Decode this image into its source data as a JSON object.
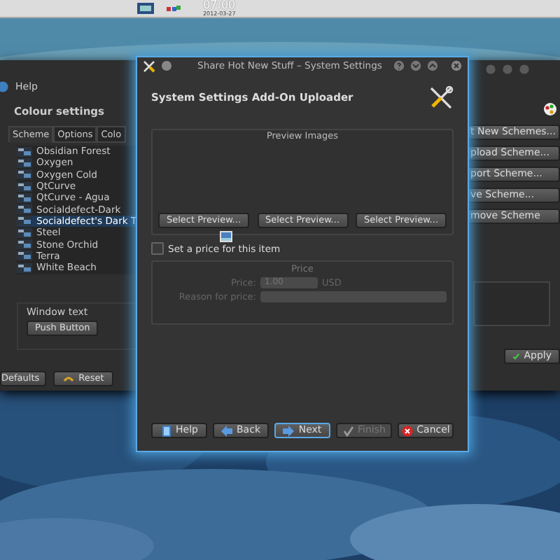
{
  "panel": {
    "clock": "07:00",
    "date": "2012-03-27"
  },
  "back_window": {
    "menu": [
      "Help"
    ],
    "title": "Colour settings",
    "tabs": [
      {
        "label": "Scheme",
        "selected": true
      },
      {
        "label": "Options",
        "selected": false
      },
      {
        "label": "Colo",
        "selected": false
      }
    ],
    "schemes": [
      {
        "name": "Obsidian Forest",
        "selected": false
      },
      {
        "name": "Oxygen",
        "selected": false
      },
      {
        "name": "Oxygen Cold",
        "selected": false
      },
      {
        "name": "QtCurve",
        "selected": false
      },
      {
        "name": "QtCurve - Agua",
        "selected": false
      },
      {
        "name": "Socialdefect-Dark",
        "selected": false
      },
      {
        "name": "Socialdefect's Dark T",
        "selected": true
      },
      {
        "name": "Steel",
        "selected": false
      },
      {
        "name": "Stone Orchid",
        "selected": false
      },
      {
        "name": "Terra",
        "selected": false
      },
      {
        "name": "White Beach",
        "selected": false
      }
    ],
    "preview_label": "Window text",
    "preview_button": "Push Button",
    "side_buttons": [
      "t New Schemes...",
      "pload Scheme...",
      "port Scheme...",
      "ve Scheme...",
      "move Scheme"
    ],
    "bottom_buttons": [
      "Defaults",
      "Reset"
    ],
    "apply_button": "Apply"
  },
  "dialog": {
    "title": "Share Hot New Stuff – System Settings",
    "heading": "System Settings Add-On Uploader",
    "preview_group": {
      "title": "Preview Images",
      "buttons": [
        "Select Preview...",
        "Select Preview...",
        "Select Preview..."
      ]
    },
    "price_checkbox": {
      "label": "Set a price for this item",
      "checked": false
    },
    "price_group": {
      "title": "Price",
      "disabled": true,
      "price_label": "Price:",
      "price_value": "1.00",
      "currency": "USD",
      "reason_label": "Reason for price:"
    },
    "buttons": [
      {
        "label": "Help",
        "kind": "help",
        "disabled": false,
        "focused": false
      },
      {
        "label": "Back",
        "kind": "back",
        "disabled": false,
        "focused": false
      },
      {
        "label": "Next",
        "kind": "next",
        "disabled": false,
        "focused": true
      },
      {
        "label": "Finish",
        "kind": "finish",
        "disabled": true,
        "focused": false
      },
      {
        "label": "Cancel",
        "kind": "cancel",
        "disabled": false,
        "focused": false
      }
    ]
  }
}
